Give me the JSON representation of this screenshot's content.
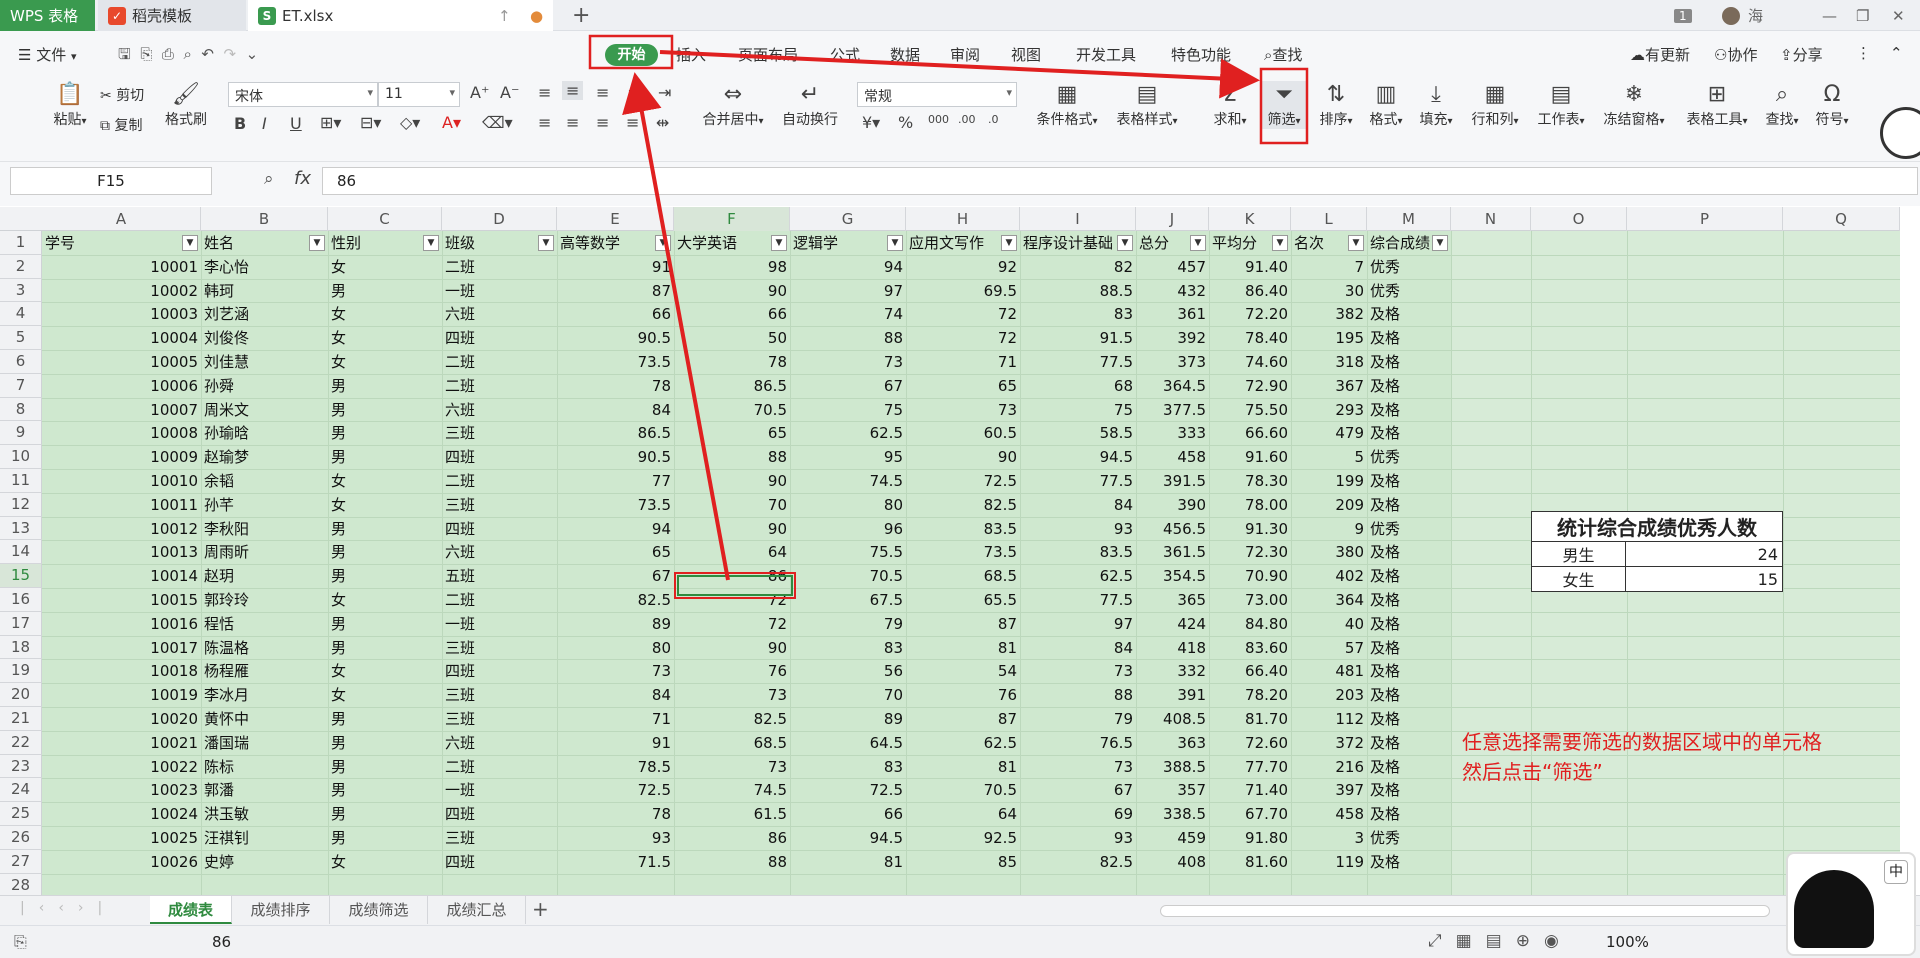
{
  "titlebar": {
    "tabs": [
      {
        "label": "WPS 表格"
      },
      {
        "label": "稻壳模板"
      },
      {
        "label": "ET.xlsx"
      }
    ],
    "user": "海",
    "count_badge": "1"
  },
  "menubar": {
    "file": "文件",
    "tabs": [
      "开始",
      "插入",
      "页面布局",
      "公式",
      "数据",
      "审阅",
      "视图",
      "开发工具",
      "特色功能"
    ],
    "search": "查找",
    "update": "有更新",
    "collab": "协作",
    "share": "分享"
  },
  "ribbon": {
    "paste": "粘贴",
    "cut": "剪切",
    "copy": "复制",
    "format_painter": "格式刷",
    "font_name": "宋体",
    "font_size": "11",
    "merge": "合并居中",
    "wrap": "自动换行",
    "number_format": "常规",
    "cond_format": "条件格式",
    "table_style": "表格样式",
    "sum": "求和",
    "filter": "筛选",
    "sort": "排序",
    "format": "格式",
    "fill": "填充",
    "rowcol": "行和列",
    "sheet": "工作表",
    "freeze": "冻结窗格",
    "table_tools": "表格工具",
    "find": "查找",
    "symbol": "符号"
  },
  "formula": {
    "cell_ref": "F15",
    "fx": "fx",
    "value": "86"
  },
  "columns": [
    "A",
    "B",
    "C",
    "D",
    "E",
    "F",
    "G",
    "H",
    "I",
    "J",
    "K",
    "L",
    "M",
    "N",
    "O",
    "P",
    "Q"
  ],
  "headers": [
    "学号",
    "姓名",
    "性别",
    "班级",
    "高等数学",
    "大学英语",
    "逻辑学",
    "应用文写作",
    "程序设计基础",
    "总分",
    "平均分",
    "名次",
    "综合成绩"
  ],
  "rows": [
    [
      "10001",
      "李心怡",
      "女",
      "二班",
      "91",
      "98",
      "94",
      "92",
      "82",
      "457",
      "91.40",
      "7",
      "优秀"
    ],
    [
      "10002",
      "韩珂",
      "男",
      "一班",
      "87",
      "90",
      "97",
      "69.5",
      "88.5",
      "432",
      "86.40",
      "30",
      "优秀"
    ],
    [
      "10003",
      "刘艺涵",
      "女",
      "六班",
      "66",
      "66",
      "74",
      "72",
      "83",
      "361",
      "72.20",
      "382",
      "及格"
    ],
    [
      "10004",
      "刘俊佟",
      "女",
      "四班",
      "90.5",
      "50",
      "88",
      "72",
      "91.5",
      "392",
      "78.40",
      "195",
      "及格"
    ],
    [
      "10005",
      "刘佳慧",
      "女",
      "二班",
      "73.5",
      "78",
      "73",
      "71",
      "77.5",
      "373",
      "74.60",
      "318",
      "及格"
    ],
    [
      "10006",
      "孙舜",
      "男",
      "二班",
      "78",
      "86.5",
      "67",
      "65",
      "68",
      "364.5",
      "72.90",
      "367",
      "及格"
    ],
    [
      "10007",
      "周米文",
      "男",
      "六班",
      "84",
      "70.5",
      "75",
      "73",
      "75",
      "377.5",
      "75.50",
      "293",
      "及格"
    ],
    [
      "10008",
      "孙瑜晗",
      "男",
      "三班",
      "86.5",
      "65",
      "62.5",
      "60.5",
      "58.5",
      "333",
      "66.60",
      "479",
      "及格"
    ],
    [
      "10009",
      "赵瑜梦",
      "男",
      "四班",
      "90.5",
      "88",
      "95",
      "90",
      "94.5",
      "458",
      "91.60",
      "5",
      "优秀"
    ],
    [
      "10010",
      "余韬",
      "女",
      "二班",
      "77",
      "90",
      "74.5",
      "72.5",
      "77.5",
      "391.5",
      "78.30",
      "199",
      "及格"
    ],
    [
      "10011",
      "孙芊",
      "女",
      "三班",
      "73.5",
      "70",
      "80",
      "82.5",
      "84",
      "390",
      "78.00",
      "209",
      "及格"
    ],
    [
      "10012",
      "李秋阳",
      "男",
      "四班",
      "94",
      "90",
      "96",
      "83.5",
      "93",
      "456.5",
      "91.30",
      "9",
      "优秀"
    ],
    [
      "10013",
      "周雨昕",
      "男",
      "六班",
      "65",
      "64",
      "75.5",
      "73.5",
      "83.5",
      "361.5",
      "72.30",
      "380",
      "及格"
    ],
    [
      "10014",
      "赵玥",
      "男",
      "五班",
      "67",
      "86",
      "70.5",
      "68.5",
      "62.5",
      "354.5",
      "70.90",
      "402",
      "及格"
    ],
    [
      "10015",
      "郭玲玲",
      "女",
      "二班",
      "82.5",
      "72",
      "67.5",
      "65.5",
      "77.5",
      "365",
      "73.00",
      "364",
      "及格"
    ],
    [
      "10016",
      "程恬",
      "男",
      "一班",
      "89",
      "72",
      "79",
      "87",
      "97",
      "424",
      "84.80",
      "40",
      "及格"
    ],
    [
      "10017",
      "陈温格",
      "男",
      "三班",
      "80",
      "90",
      "83",
      "81",
      "84",
      "418",
      "83.60",
      "57",
      "及格"
    ],
    [
      "10018",
      "杨程雁",
      "女",
      "四班",
      "73",
      "76",
      "56",
      "54",
      "73",
      "332",
      "66.40",
      "481",
      "及格"
    ],
    [
      "10019",
      "李冰月",
      "女",
      "三班",
      "84",
      "73",
      "70",
      "76",
      "88",
      "391",
      "78.20",
      "203",
      "及格"
    ],
    [
      "10020",
      "黄怀中",
      "男",
      "三班",
      "71",
      "82.5",
      "89",
      "87",
      "79",
      "408.5",
      "81.70",
      "112",
      "及格"
    ],
    [
      "10021",
      "潘国瑞",
      "男",
      "六班",
      "91",
      "68.5",
      "64.5",
      "62.5",
      "76.5",
      "363",
      "72.60",
      "372",
      "及格"
    ],
    [
      "10022",
      "陈标",
      "男",
      "二班",
      "78.5",
      "73",
      "83",
      "81",
      "73",
      "388.5",
      "77.70",
      "216",
      "及格"
    ],
    [
      "10023",
      "郭潘",
      "男",
      "一班",
      "72.5",
      "74.5",
      "72.5",
      "70.5",
      "67",
      "357",
      "71.40",
      "397",
      "及格"
    ],
    [
      "10024",
      "洪玉敏",
      "男",
      "四班",
      "78",
      "61.5",
      "66",
      "64",
      "69",
      "338.5",
      "67.70",
      "458",
      "及格"
    ],
    [
      "10025",
      "汪祺钊",
      "男",
      "三班",
      "93",
      "86",
      "94.5",
      "92.5",
      "93",
      "459",
      "91.80",
      "3",
      "优秀"
    ],
    [
      "10026",
      "史婷",
      "女",
      "四班",
      "71.5",
      "88",
      "81",
      "85",
      "82.5",
      "408",
      "81.60",
      "119",
      "及格"
    ]
  ],
  "stat": {
    "title": "统计综合成绩优秀人数",
    "rows": [
      {
        "label": "男生",
        "value": "24"
      },
      {
        "label": "女生",
        "value": "15"
      }
    ]
  },
  "note": {
    "line1": "任意选择需要筛选的数据区域中的单元格",
    "line2": "然后点击“筛选”"
  },
  "sheets": [
    "成绩表",
    "成绩排序",
    "成绩筛选",
    "成绩汇总"
  ],
  "status": {
    "value": "86",
    "zoom": "100%"
  },
  "colors": {
    "accent": "#3a9a4f",
    "annotation": "#e02020",
    "selection_bg": "#cfe8cf"
  }
}
